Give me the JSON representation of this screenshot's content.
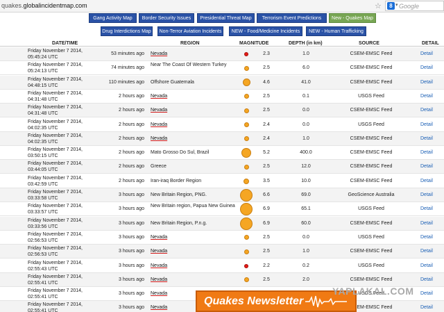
{
  "browser": {
    "url_prefix": "quakes.",
    "url_domain": "globalincidentmap.com",
    "search_placeholder": "Google",
    "search_engine_badge": "8"
  },
  "nav": {
    "row1": [
      "Gang Activity Map",
      "Border Security Issues",
      "Presidential Threat Map",
      "Terrorism Event Predictions",
      "New - Quakes Map"
    ],
    "row2": [
      "Drug Interdictions Map",
      "Non-Terror Aviation Incidents",
      "NEW - Food/Medicine Incidents",
      "NEW - Human Trafficking"
    ],
    "active": "New - Quakes Map"
  },
  "table": {
    "headers": {
      "datetime": "DATE/TIME",
      "region": "REGION",
      "magnitude": "MAGNITUDE",
      "depth": "DEPTH (in km)",
      "source": "SOURCE",
      "detail": "DETAIL"
    },
    "detail_label": "Detail",
    "rows": [
      {
        "date": "Friday November 7 2014, 05:45:24 UTC",
        "ago": "53 minutes ago",
        "region": "Nevada",
        "mag": "2.3",
        "depth": "1.0",
        "source": "CSEM-EMSC Feed"
      },
      {
        "date": "Friday November 7 2014, 05:24:13 UTC",
        "ago": "74 minutes ago",
        "region": "Near The Coast Of Western Turkey",
        "mag": "2.5",
        "depth": "6.0",
        "source": "CSEM-EMSC Feed"
      },
      {
        "date": "Friday November 7 2014, 04:48:15 UTC",
        "ago": "110 minutes ago",
        "region": "Offshore Guatemala",
        "mag": "4.6",
        "depth": "41.0",
        "source": "CSEM-EMSC Feed"
      },
      {
        "date": "Friday November 7 2014, 04:31:48 UTC",
        "ago": "2 hours ago",
        "region": "Nevada",
        "mag": "2.5",
        "depth": "0.1",
        "source": "USGS Feed"
      },
      {
        "date": "Friday November 7 2014, 04:31:48 UTC",
        "ago": "2 hours ago",
        "region": "Nevada",
        "mag": "2.5",
        "depth": "0.0",
        "source": "CSEM-EMSC Feed"
      },
      {
        "date": "Friday November 7 2014, 04:02:35 UTC",
        "ago": "2 hours ago",
        "region": "Nevada",
        "mag": "2.4",
        "depth": "0.0",
        "source": "USGS Feed"
      },
      {
        "date": "Friday November 7 2014, 04:02:35 UTC",
        "ago": "2 hours ago",
        "region": "Nevada",
        "mag": "2.4",
        "depth": "1.0",
        "source": "CSEM-EMSC Feed"
      },
      {
        "date": "Friday November 7 2014, 03:50:15 UTC",
        "ago": "2 hours ago",
        "region": "Mato Grosso Do Sul, Brazil",
        "mag": "5.2",
        "depth": "400.0",
        "source": "CSEM-EMSC Feed"
      },
      {
        "date": "Friday November 7 2014, 03:44:05 UTC",
        "ago": "2 hours ago",
        "region": "Greece",
        "mag": "2.5",
        "depth": "12.0",
        "source": "CSEM-EMSC Feed"
      },
      {
        "date": "Friday November 7 2014, 03:42:59 UTC",
        "ago": "2 hours ago",
        "region": "Iran-iraq Border Region",
        "mag": "3.5",
        "depth": "10.0",
        "source": "CSEM-EMSC Feed"
      },
      {
        "date": "Friday November 7 2014, 03:33:58 UTC",
        "ago": "3 hours ago",
        "region": "New Britain Region, PNG.",
        "mag": "6.6",
        "depth": "69.0",
        "source": "GeoScience Australia"
      },
      {
        "date": "Friday November 7 2014, 03:33:57 UTC",
        "ago": "3 hours ago",
        "region": "New Britain region, Papua New Guinea",
        "mag": "6.9",
        "depth": "65.1",
        "source": "USGS Feed"
      },
      {
        "date": "Friday November 7 2014, 03:33:56 UTC",
        "ago": "3 hours ago",
        "region": "New Britain Region, P.n.g.",
        "mag": "6.9",
        "depth": "60.0",
        "source": "CSEM-EMSC Feed"
      },
      {
        "date": "Friday November 7 2014, 02:56:53 UTC",
        "ago": "3 hours ago",
        "region": "Nevada",
        "mag": "2.5",
        "depth": "0.0",
        "source": "USGS Feed"
      },
      {
        "date": "Friday November 7 2014, 02:56:53 UTC",
        "ago": "3 hours ago",
        "region": "Nevada",
        "mag": "2.5",
        "depth": "1.0",
        "source": "CSEM-EMSC Feed"
      },
      {
        "date": "Friday November 7 2014, 02:55:43 UTC",
        "ago": "3 hours ago",
        "region": "Nevada",
        "mag": "2.2",
        "depth": "0.2",
        "source": "USGS Feed"
      },
      {
        "date": "Friday November 7 2014, 02:55:41 UTC",
        "ago": "3 hours ago",
        "region": "Nevada",
        "mag": "2.5",
        "depth": "2.0",
        "source": "CSEM-EMSC Feed"
      },
      {
        "date": "Friday November 7 2014, 02:55:41 UTC",
        "ago": "3 hours ago",
        "region": "Nevada",
        "mag": "",
        "depth": "",
        "source": "USGS Feed"
      },
      {
        "date": "Friday November 7 2014, 02:55:41 UTC",
        "ago": "3 hours ago",
        "region": "Nevada",
        "mag": "",
        "depth": "",
        "source": "CSEM-EMSC Feed"
      }
    ]
  },
  "newsletter": {
    "label": "Quakes Newsletter"
  },
  "watermark": {
    "text": "YAPLAKAL.COM"
  },
  "colors": {
    "nav_blue": "#2a52a6",
    "nav_active": "#78a654",
    "dot_orange": "#f5a623",
    "dot_red": "#e41b17",
    "detail_link": "#1a5fb5",
    "newsletter_orange": "#f07a14"
  }
}
